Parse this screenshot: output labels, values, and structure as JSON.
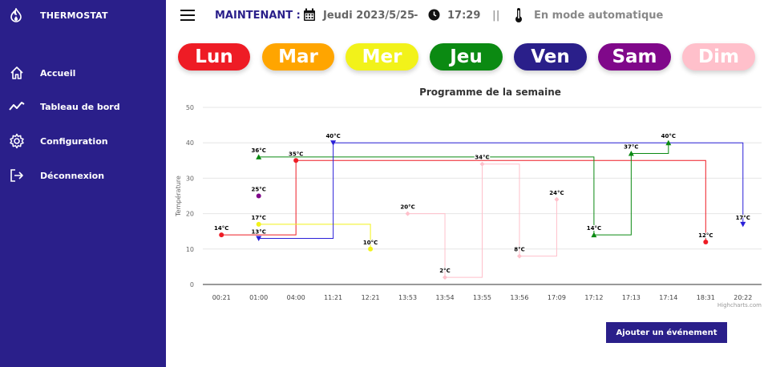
{
  "sidebar": {
    "brand": "THERMOSTAT",
    "items": [
      {
        "label": "Accueil",
        "icon": "home-icon"
      },
      {
        "label": "Tableau de bord",
        "icon": "trend-icon"
      },
      {
        "label": "Configuration",
        "icon": "gear-icon"
      },
      {
        "label": "Déconnexion",
        "icon": "logout-icon"
      }
    ]
  },
  "header": {
    "now_label": "MAINTENANT :",
    "date": "Jeudi 2023/5/25",
    "dash": "-",
    "time": "17:29",
    "separator": "||",
    "mode": "En mode automatique"
  },
  "days": [
    {
      "label": "Lun",
      "color": "#ee1c25"
    },
    {
      "label": "Mar",
      "color": "#ffa500"
    },
    {
      "label": "Mer",
      "color": "#f2f21a"
    },
    {
      "label": "Jeu",
      "color": "#0b8a12"
    },
    {
      "label": "Ven",
      "color": "#2a1f8a"
    },
    {
      "label": "Sam",
      "color": "#80088a"
    },
    {
      "label": "Dim",
      "color": "#ffc0cb"
    }
  ],
  "add_button": "Ajouter un événement",
  "chart_data": {
    "type": "line",
    "step": "left",
    "title": "Programme de la semaine",
    "ylabel": "Température",
    "xlabel": "",
    "categories": [
      "00:21",
      "01:00",
      "04:00",
      "11:21",
      "12:21",
      "13:53",
      "13:54",
      "13:55",
      "13:56",
      "17:09",
      "17:12",
      "17:13",
      "17:14",
      "18:31",
      "20:22"
    ],
    "y_ticks": [
      0,
      10,
      20,
      30,
      40,
      50
    ],
    "ylim": [
      0,
      50
    ],
    "grid": true,
    "credits": "Highcharts.com",
    "series": [
      {
        "color": "#ee1c25",
        "marker": "circle",
        "points": [
          [
            0,
            14
          ],
          [
            2,
            35
          ],
          [
            13,
            12
          ]
        ]
      },
      {
        "color": "#f2f21a",
        "marker": "circle",
        "points": [
          [
            1,
            17
          ],
          [
            4,
            10
          ]
        ]
      },
      {
        "color": "#0b8a12",
        "marker": "triangle",
        "points": [
          [
            1,
            36
          ],
          [
            10,
            14
          ],
          [
            11,
            37
          ],
          [
            12,
            40
          ]
        ]
      },
      {
        "color": "#2a1fd8",
        "marker": "triangle-down",
        "points": [
          [
            1,
            13
          ],
          [
            3,
            40
          ],
          [
            14,
            17
          ]
        ]
      },
      {
        "color": "#80088a",
        "marker": "circle",
        "points": [
          [
            1,
            25
          ]
        ]
      },
      {
        "color": "#ffc0cb",
        "marker": "diamond",
        "points": [
          [
            5,
            20
          ],
          [
            6,
            2
          ],
          [
            7,
            34
          ],
          [
            8,
            8
          ],
          [
            9,
            24
          ]
        ]
      }
    ],
    "point_suffix": "°C"
  }
}
